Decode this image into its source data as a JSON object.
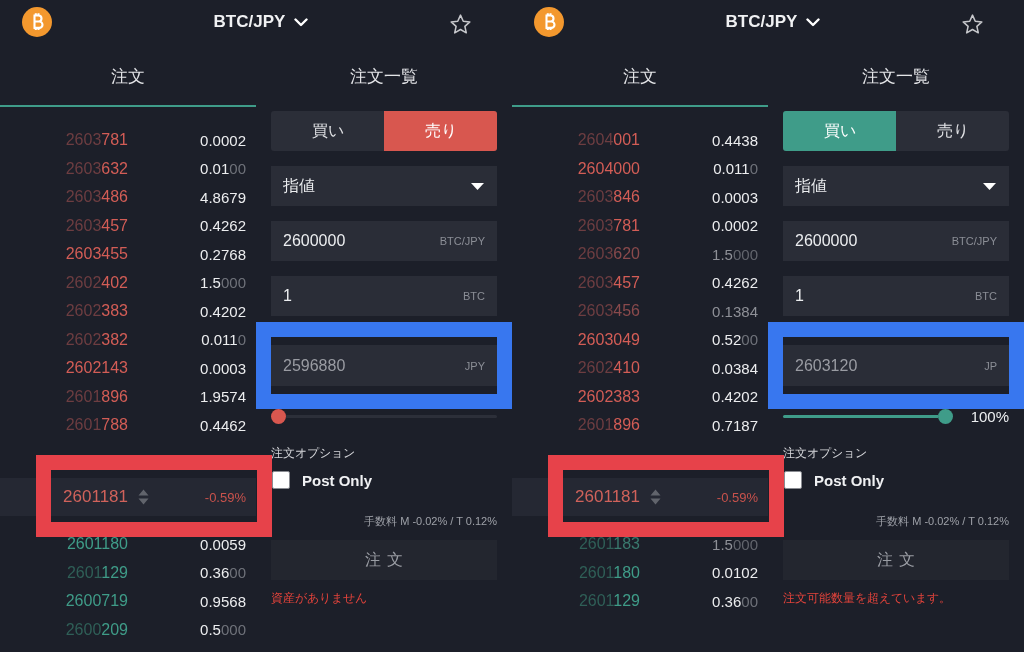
{
  "panels": [
    {
      "header": {
        "pair": "BTC/JPY"
      },
      "tabs": [
        {
          "label": "注文",
          "selected": true
        },
        {
          "label": "注文一覧",
          "selected": false
        }
      ],
      "order_book": {
        "asks": [
          {
            "price_muted": "2603",
            "price_bright": "781",
            "size_bright": "0.0002",
            "faded": false
          },
          {
            "price_muted": "2603",
            "price_bright": "632",
            "size_bright": "0.01",
            "size_muted": "00",
            "faded": false
          },
          {
            "price_muted": "2603",
            "price_bright": "486",
            "size_bright": "4.8679",
            "faded": false
          },
          {
            "price_muted": "2603",
            "price_bright": "457",
            "size_bright": "0.4262",
            "faded": false
          },
          {
            "price_bright": "2603455",
            "size_bright": "0.2768",
            "faded": false
          },
          {
            "price_muted": "2602",
            "price_bright": "402",
            "size_bright": "1.5",
            "size_muted": "000",
            "faded": false
          },
          {
            "price_muted": "2602",
            "price_bright": "383",
            "size_bright": "0.4202",
            "faded": false
          },
          {
            "price_muted": "2602",
            "price_bright": "382",
            "size_bright": "0.011",
            "size_muted": "0",
            "faded": false
          },
          {
            "price_bright": "2602143",
            "size_bright": "0.0003",
            "faded": false
          },
          {
            "price_muted": "2601",
            "price_bright": "896",
            "size_bright": "1.9574",
            "faded": false
          },
          {
            "price_muted": "2601",
            "price_bright": "788",
            "size_bright": "0.4462",
            "faded": false
          }
        ],
        "mid_price": {
          "price": "2601181",
          "change": "-0.59%",
          "highlighted": true
        },
        "bids": [
          {
            "price_bright": "2601180",
            "size_bright": "0.0059",
            "faded": false
          },
          {
            "price_muted": "2601",
            "price_bright": "129",
            "size_bright": "0.36",
            "size_muted": "00",
            "faded": false
          },
          {
            "price_bright": "2600719",
            "size_bright": "0.9568",
            "faded": false
          },
          {
            "price_muted": "2600",
            "price_bright": "209",
            "size_bright": "0.5",
            "size_muted": "000",
            "faded": false
          }
        ]
      },
      "order_form": {
        "sides": [
          {
            "kind": "buy",
            "label": "買い",
            "selected": false
          },
          {
            "kind": "sell",
            "label": "売り",
            "selected": true
          }
        ],
        "order_type": {
          "value": "指値"
        },
        "fields": [
          {
            "kind": "price",
            "value": "2600000",
            "unit": "BTC/JPY"
          },
          {
            "kind": "amount",
            "value": "1",
            "unit": "BTC"
          },
          {
            "kind": "total",
            "value": "2596880",
            "unit": "JPY",
            "highlighted": true
          }
        ],
        "slider": {
          "level": 0
        },
        "options_label": "注文オプション",
        "post_only": {
          "label": "Post Only",
          "checked": false
        },
        "fee": "手数料 M -0.02% / T 0.12%",
        "submit": {
          "label": "注文",
          "disabled": true
        },
        "error": "資産がありません"
      }
    },
    {
      "header": {
        "pair": "BTC/JPY"
      },
      "tabs": [
        {
          "label": "注文",
          "selected": true
        },
        {
          "label": "注文一覧",
          "selected": false
        }
      ],
      "order_book": {
        "asks": [
          {
            "price_muted": "2604",
            "price_bright": "001",
            "size_bright": "0.4438",
            "faded": false
          },
          {
            "price_bright": "2604000",
            "size_bright": "0.011",
            "size_muted": "0",
            "faded": false
          },
          {
            "price_muted": "2603",
            "price_bright": "846",
            "size_bright": "0.0003",
            "faded": false
          },
          {
            "price_muted": "2603",
            "price_bright": "781",
            "size_bright": "0.0002",
            "faded": false
          },
          {
            "price_muted": "2603",
            "price_bright": "620",
            "size_bright": "1.5",
            "size_muted": "000",
            "faded": true
          },
          {
            "price_muted": "2603",
            "price_bright": "457",
            "size_bright": "0.4262",
            "faded": false
          },
          {
            "price_muted": "2603",
            "price_bright": "456",
            "size_bright": "0.1384",
            "faded": true
          },
          {
            "price_bright": "2603049",
            "size_bright": "0.52",
            "size_muted": "00",
            "faded": false
          },
          {
            "price_muted": "2602",
            "price_bright": "410",
            "size_bright": "0.0384",
            "faded": false
          },
          {
            "price_bright": "2602383",
            "size_bright": "0.4202",
            "faded": false
          },
          {
            "price_muted": "2601",
            "price_bright": "896",
            "size_bright": "0.7187",
            "faded": false
          }
        ],
        "mid_price": {
          "price": "2601181",
          "change": "-0.59%",
          "highlighted": true
        },
        "bids": [
          {
            "price_muted": "2601",
            "price_bright": "183",
            "size_bright": "1.5",
            "size_muted": "000",
            "faded": true
          },
          {
            "price_muted": "2601",
            "price_bright": "180",
            "size_bright": "0.0102",
            "faded": false
          },
          {
            "price_muted": "2601",
            "price_bright": "129",
            "size_bright": "0.36",
            "size_muted": "00",
            "faded": false
          }
        ]
      },
      "order_form": {
        "sides": [
          {
            "kind": "buy",
            "label": "買い",
            "selected": true
          },
          {
            "kind": "sell",
            "label": "売り",
            "selected": false
          }
        ],
        "order_type": {
          "value": "指値"
        },
        "fields": [
          {
            "kind": "price",
            "value": "2600000",
            "unit": "BTC/JPY"
          },
          {
            "kind": "amount",
            "value": "1",
            "unit": "BTC"
          },
          {
            "kind": "total",
            "value": "2603120",
            "unit": "JP",
            "highlighted": true
          }
        ],
        "slider": {
          "level": 1,
          "reading": "100%"
        },
        "options_label": "注文オプション",
        "post_only": {
          "label": "Post Only",
          "checked": false
        },
        "fee": "手数料 M -0.02% / T 0.12%",
        "submit": {
          "label": "注文",
          "disabled": true
        },
        "error": "注文可能数量を超えています。"
      }
    }
  ]
}
